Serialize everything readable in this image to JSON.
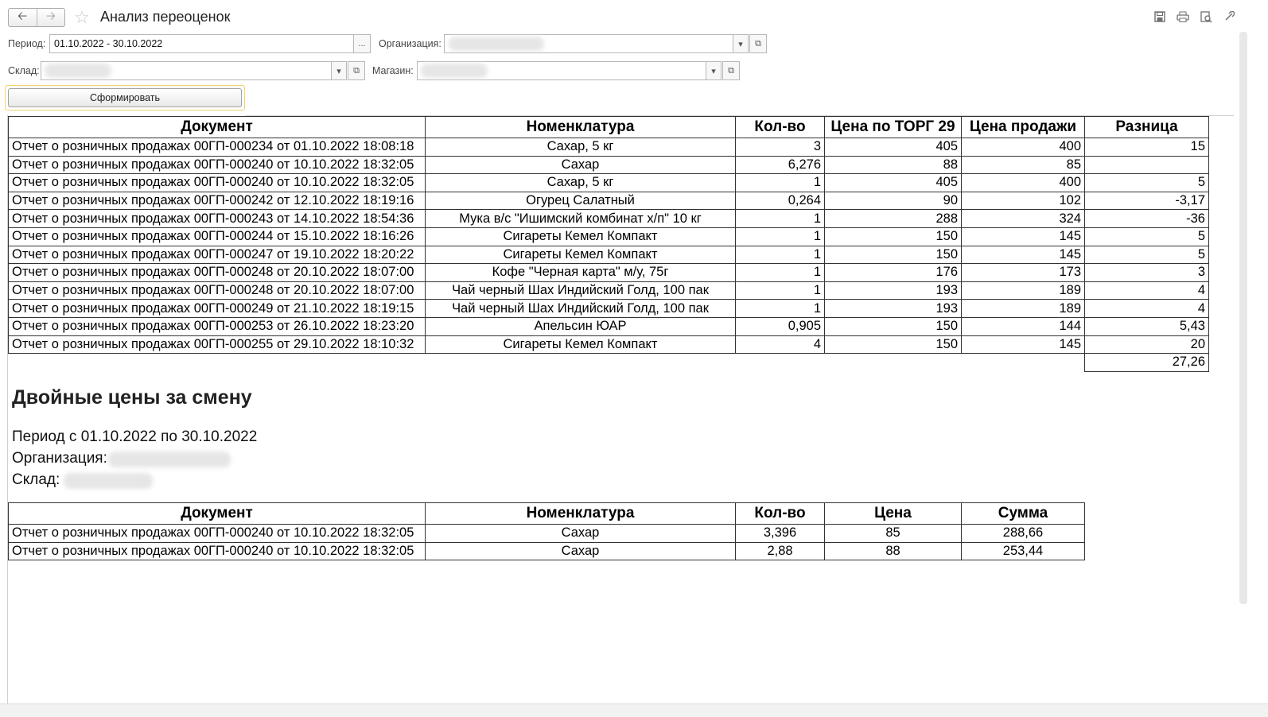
{
  "window": {
    "title": "Анализ переоценок",
    "toolbar_icons": [
      "back-arrow-icon",
      "forward-arrow-icon",
      "star-icon",
      "save-icon",
      "print-icon",
      "preview-icon",
      "link-icon"
    ]
  },
  "filters": {
    "period_label": "Период:",
    "period_value": "01.10.2022 - 30.10.2022",
    "period_button": "...",
    "organization_label": "Организация:",
    "warehouse_label": "Склад:",
    "shop_label": "Магазин:"
  },
  "generate_button": "Сформировать",
  "report1": {
    "headers": [
      "Документ",
      "Номенклатура",
      "Кол-во",
      "Цена по ТОРГ 29",
      "Цена продажи",
      "Разница"
    ],
    "rows": [
      [
        "Отчет о розничных продажах 00ГП-000234 от 01.10.2022 18:08:18",
        "Сахар, 5 кг",
        "3",
        "405",
        "400",
        "15"
      ],
      [
        "Отчет о розничных продажах 00ГП-000240 от 10.10.2022 18:32:05",
        "Сахар",
        "6,276",
        "88",
        "85",
        ""
      ],
      [
        "Отчет о розничных продажах 00ГП-000240 от 10.10.2022 18:32:05",
        "Сахар, 5 кг",
        "1",
        "405",
        "400",
        "5"
      ],
      [
        "Отчет о розничных продажах 00ГП-000242 от 12.10.2022 18:19:16",
        "Огурец Салатный",
        "0,264",
        "90",
        "102",
        "-3,17"
      ],
      [
        "Отчет о розничных продажах 00ГП-000243 от 14.10.2022 18:54:36",
        "Мука в/с \"Ишимский комбинат х/п\" 10 кг",
        "1",
        "288",
        "324",
        "-36"
      ],
      [
        "Отчет о розничных продажах 00ГП-000244 от 15.10.2022 18:16:26",
        "Сигареты Кемел Компакт",
        "1",
        "150",
        "145",
        "5"
      ],
      [
        "Отчет о розничных продажах 00ГП-000247 от 19.10.2022 18:20:22",
        "Сигареты Кемел Компакт",
        "1",
        "150",
        "145",
        "5"
      ],
      [
        "Отчет о розничных продажах 00ГП-000248 от 20.10.2022 18:07:00",
        "Кофе \"Черная карта\" м/у, 75г",
        "1",
        "176",
        "173",
        "3"
      ],
      [
        "Отчет о розничных продажах 00ГП-000248 от 20.10.2022 18:07:00",
        "Чай черный Шах Индийский Голд, 100 пак",
        "1",
        "193",
        "189",
        "4"
      ],
      [
        "Отчет о розничных продажах 00ГП-000249 от 21.10.2022 18:19:15",
        "Чай черный Шах Индийский Голд, 100 пак",
        "1",
        "193",
        "189",
        "4"
      ],
      [
        "Отчет о розничных продажах 00ГП-000253 от 26.10.2022 18:23:20",
        "Апельсин ЮАР",
        "0,905",
        "150",
        "144",
        "5,43"
      ],
      [
        "Отчет о розничных продажах 00ГП-000255 от 29.10.2022 18:10:32",
        "Сигареты Кемел Компакт",
        "4",
        "150",
        "145",
        "20"
      ]
    ],
    "total": "27,26"
  },
  "section2": {
    "title": "Двойные цены за смену",
    "period_text": "Период с 01.10.2022 по 30.10.2022",
    "organization_label": "Организация:",
    "warehouse_label": "Склад:"
  },
  "report2": {
    "headers": [
      "Документ",
      "Номенклатура",
      "Кол-во",
      "Цена",
      "Сумма"
    ],
    "rows": [
      [
        "Отчет о розничных продажах 00ГП-000240 от 10.10.2022 18:32:05",
        "Сахар",
        "3,396",
        "85",
        "288,66"
      ],
      [
        "Отчет о розничных продажах 00ГП-000240 от 10.10.2022 18:32:05",
        "Сахар",
        "2,88",
        "88",
        "253,44"
      ]
    ]
  }
}
